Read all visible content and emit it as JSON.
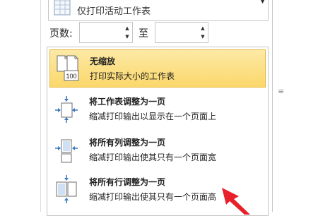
{
  "scaling_dropdown": {
    "selected_text": "仅打印活动工作表"
  },
  "pages": {
    "label": "页数:",
    "to_label": "至",
    "from_value": "",
    "to_value": ""
  },
  "scaling_options": [
    {
      "title": "无缩放",
      "description": "打印实际大小的工作表",
      "selected": true,
      "icon_label": "100"
    },
    {
      "title": "将工作表调整为一页",
      "description": "缩减打印输出以显示在一个页面上",
      "selected": false
    },
    {
      "title": "将所有列调整为一页",
      "description": "缩减打印输出使其只有一个页面宽",
      "selected": false
    },
    {
      "title": "将所有行调整为一页",
      "description": "缩减打印输出使其只有一个页面高",
      "selected": false
    }
  ],
  "colors": {
    "highlight": "#fbd86b",
    "annotation_arrow": "#e8202a",
    "icon_blue": "#3a78c2"
  }
}
